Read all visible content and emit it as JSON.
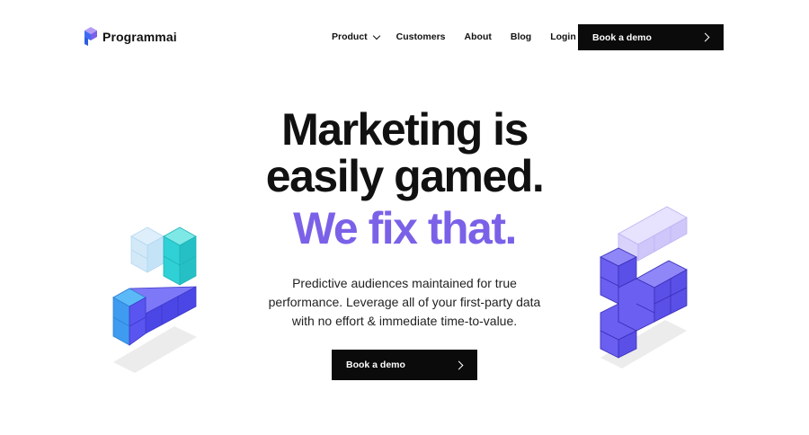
{
  "brand": {
    "name": "Programmai",
    "logo_icon": "programmai-logo-icon"
  },
  "nav": {
    "product": "Product",
    "customers": "Customers",
    "about": "About",
    "blog": "Blog",
    "login": "Login"
  },
  "header_cta": {
    "label": "Book a demo"
  },
  "hero": {
    "title_line1": "Marketing is",
    "title_line2": "easily gamed.",
    "accent": "We fix that.",
    "subtitle_line1": "Predictive audiences maintained for true",
    "subtitle_line2": "performance. Leverage all of your first-party data",
    "subtitle_line3": "with no effort & immediate time-to-value.",
    "cta_label": "Book a demo"
  },
  "colors": {
    "accent": "#7b61e8",
    "button_bg": "#0b0b0b",
    "cube_blue": "#5a55f0",
    "cube_cyan": "#2fd1d6",
    "cube_light_blue": "#bfe0f7",
    "cube_lavender": "#d9d2fb"
  }
}
